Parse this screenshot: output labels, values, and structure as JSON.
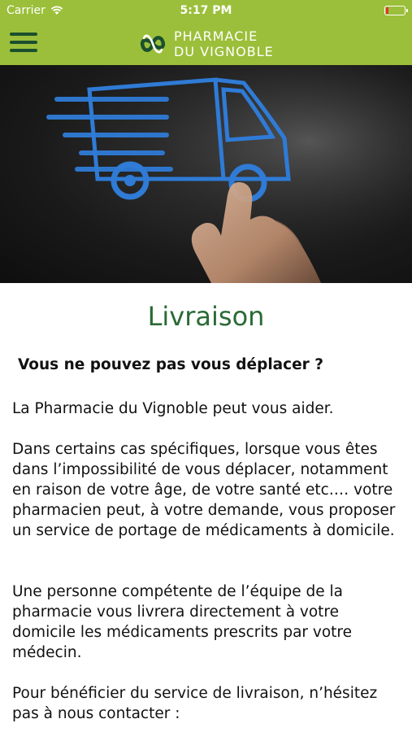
{
  "status_bar": {
    "carrier": "Carrier",
    "time": "5:17 PM"
  },
  "nav": {
    "logo_line1": "PHARMACIE",
    "logo_line2": "DU VIGNOBLE"
  },
  "colors": {
    "brand_green": "#9bbf3a",
    "dark_green": "#1b4f2e",
    "title_green": "#2a6a35",
    "truck_blue": "#2f7bd6"
  },
  "content": {
    "title": "Livraison",
    "subtitle": "Vous ne pouvez pas vous déplacer ?",
    "p1": "La Pharmacie du Vignoble peut vous aider.",
    "p2": "Dans certains cas spécifiques, lorsque vous êtes dans l’impossibilité de vous déplacer, notamment en raison de votre âge, de votre santé etc.… votre pharmacien peut, à votre demande, vous proposer un service de portage de médicaments à domicile.",
    "p3": " Une personne compétente de l’équipe de la pharmacie vous livrera directement à votre domicile les médicaments prescrits par votre médecin.",
    "p4": "Pour bénéficier du service de livraison, n’hésitez pas à nous contacter :"
  }
}
